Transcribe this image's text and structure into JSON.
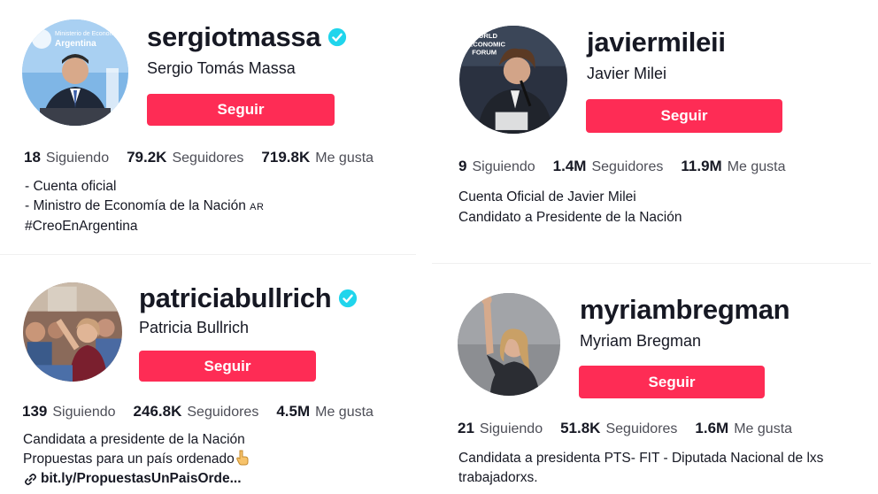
{
  "profiles": [
    {
      "username": "sergiotmassa",
      "verified": true,
      "display_name": "Sergio Tomás Massa",
      "button_label": "Seguir",
      "following_count": "18",
      "following_label": "Siguiendo",
      "followers_count": "79.2K",
      "followers_label": "Seguidores",
      "likes_count": "719.8K",
      "likes_label": "Me gusta",
      "bio_lines": [
        "- Cuenta oficial",
        "- Ministro de Economía de la Nación",
        "#CreoEnArgentina"
      ],
      "bio_flag": "AR",
      "avatar_texts": [
        "Ministerio de Economía",
        "Argentina"
      ]
    },
    {
      "username": "javiermileii",
      "verified": false,
      "display_name": "Javier Milei",
      "button_label": "Seguir",
      "following_count": "9",
      "following_label": "Siguiendo",
      "followers_count": "1.4M",
      "followers_label": "Seguidores",
      "likes_count": "11.9M",
      "likes_label": "Me gusta",
      "bio_lines": [
        "Cuenta Oficial de Javier Milei",
        "Candidato a Presidente de la Nación"
      ],
      "avatar_texts": [
        "WORLD",
        "ECONOMIC",
        "FORUM"
      ]
    },
    {
      "username": "patriciabullrich",
      "verified": true,
      "display_name": "Patricia Bullrich",
      "button_label": "Seguir",
      "following_count": "139",
      "following_label": "Siguiendo",
      "followers_count": "246.8K",
      "followers_label": "Seguidores",
      "likes_count": "4.5M",
      "likes_label": "Me gusta",
      "bio_lines": [
        "Candidata a presidente de la Nación",
        "Propuestas para un país ordenado"
      ],
      "bio_link": "bit.ly/PropuestasUnPaisOrde..."
    },
    {
      "username": "myriambregman",
      "verified": false,
      "display_name": "Myriam Bregman",
      "button_label": "Seguir",
      "following_count": "21",
      "following_label": "Siguiendo",
      "followers_count": "51.8K",
      "followers_label": "Seguidores",
      "likes_count": "1.6M",
      "likes_label": "Me gusta",
      "bio_lines": [
        "Candidata a presidenta PTS- FIT - Diputada Nacional de lxs",
        "trabajadorxs."
      ]
    }
  ],
  "colors": {
    "follow_button": "#fe2c55",
    "verified_badge": "#20d5ec",
    "text_primary": "#161823",
    "text_secondary": "#4d4e57"
  },
  "icons": {
    "verified": "verified-badge-icon",
    "link": "link-icon",
    "pointing_hand": "pointing-down-hand-icon"
  }
}
